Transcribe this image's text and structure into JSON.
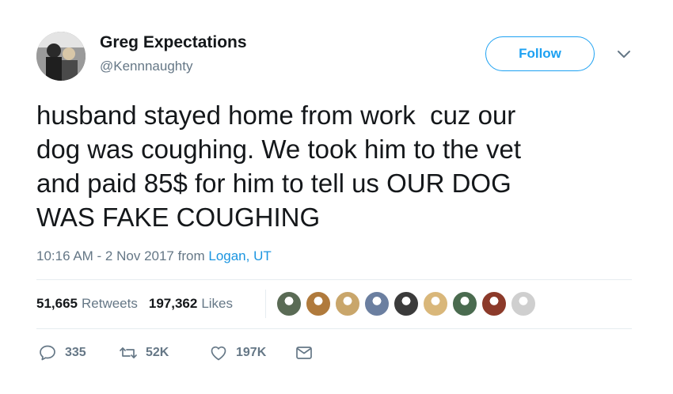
{
  "author": {
    "display_name": "Greg Expectations",
    "handle": "@Kennnaughty",
    "avatar_icon": "profile-photo"
  },
  "follow": {
    "label": "Follow",
    "accent_color": "#1da1f2"
  },
  "tweet": {
    "text": "husband stayed home from work  cuz our\ndog was coughing. We took him to the vet\nand paid 85$ for him to tell us OUR DOG\nWAS FAKE COUGHING"
  },
  "meta": {
    "timestamp": "10:16 AM - 2 Nov 2017",
    "from_label": "from",
    "location": "Logan, UT"
  },
  "stats": {
    "retweets_count": "51,665",
    "retweets_label": "Retweets",
    "likes_count": "197,362",
    "likes_label": "Likes"
  },
  "likers": [
    {
      "name": "liker-avatar-1",
      "color": "#5a6b55"
    },
    {
      "name": "liker-avatar-2",
      "color": "#b07a3c"
    },
    {
      "name": "liker-avatar-3",
      "color": "#c9a66b"
    },
    {
      "name": "liker-avatar-4",
      "color": "#6b7fa0"
    },
    {
      "name": "liker-avatar-5",
      "color": "#3b3b3b"
    },
    {
      "name": "liker-avatar-6",
      "color": "#d9b77a"
    },
    {
      "name": "liker-avatar-7",
      "color": "#4a6b4f"
    },
    {
      "name": "liker-avatar-8",
      "color": "#8c3a2a"
    },
    {
      "name": "liker-avatar-9",
      "color": "#cfcfcf"
    }
  ],
  "actions": {
    "replies": "335",
    "retweets": "52K",
    "likes": "197K"
  },
  "colors": {
    "text": "#14171a",
    "secondary": "#657786",
    "link": "#1b95e0",
    "divider": "#e6ecf0"
  }
}
